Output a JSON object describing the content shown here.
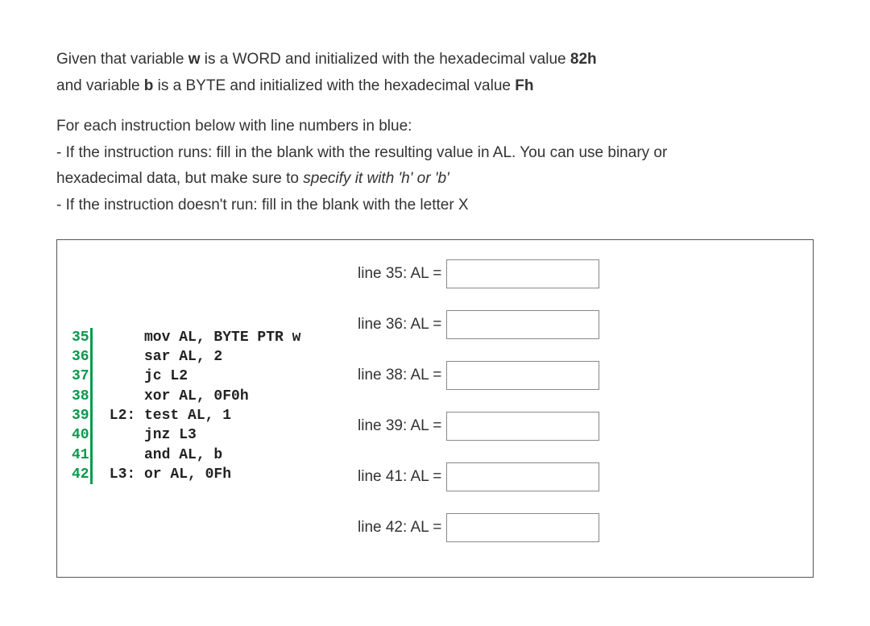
{
  "intro": {
    "line1_a": "Given that variable ",
    "line1_b": "w",
    "line1_c": " is a WORD and initialized with the hexadecimal value ",
    "line1_d": "82h",
    "line2_a": "and variable ",
    "line2_b": "b",
    "line2_c": " is a BYTE and initialized with the hexadecimal value ",
    "line2_d": "Fh",
    "line3": "For each instruction below with line numbers in blue:",
    "line4": "- If the instruction runs: fill in the blank with the resulting value in AL. You can use binary or",
    "line5_a": "hexadecimal data, but make sure to ",
    "line5_b": "specify it with 'h' or 'b'",
    "line6": "- If the instruction doesn't run: fill in the blank with the letter X"
  },
  "code": [
    {
      "n": "35",
      "t": "     mov AL, BYTE PTR w"
    },
    {
      "n": "36",
      "t": "     sar AL, 2"
    },
    {
      "n": "37",
      "t": "     jc L2"
    },
    {
      "n": "38",
      "t": "     xor AL, 0F0h"
    },
    {
      "n": "39",
      "t": " L2: test AL, 1"
    },
    {
      "n": "40",
      "t": "     jnz L3"
    },
    {
      "n": "41",
      "t": "     and AL, b"
    },
    {
      "n": "42",
      "t": " L3: or AL, 0Fh"
    }
  ],
  "answers": [
    {
      "label": "line 35: AL =",
      "value": ""
    },
    {
      "label": "line 36: AL =",
      "value": ""
    },
    {
      "label": "line 38: AL =",
      "value": ""
    },
    {
      "label": "line 39: AL =",
      "value": ""
    },
    {
      "label": "line 41: AL =",
      "value": ""
    },
    {
      "label": "line 42: AL =",
      "value": ""
    }
  ]
}
